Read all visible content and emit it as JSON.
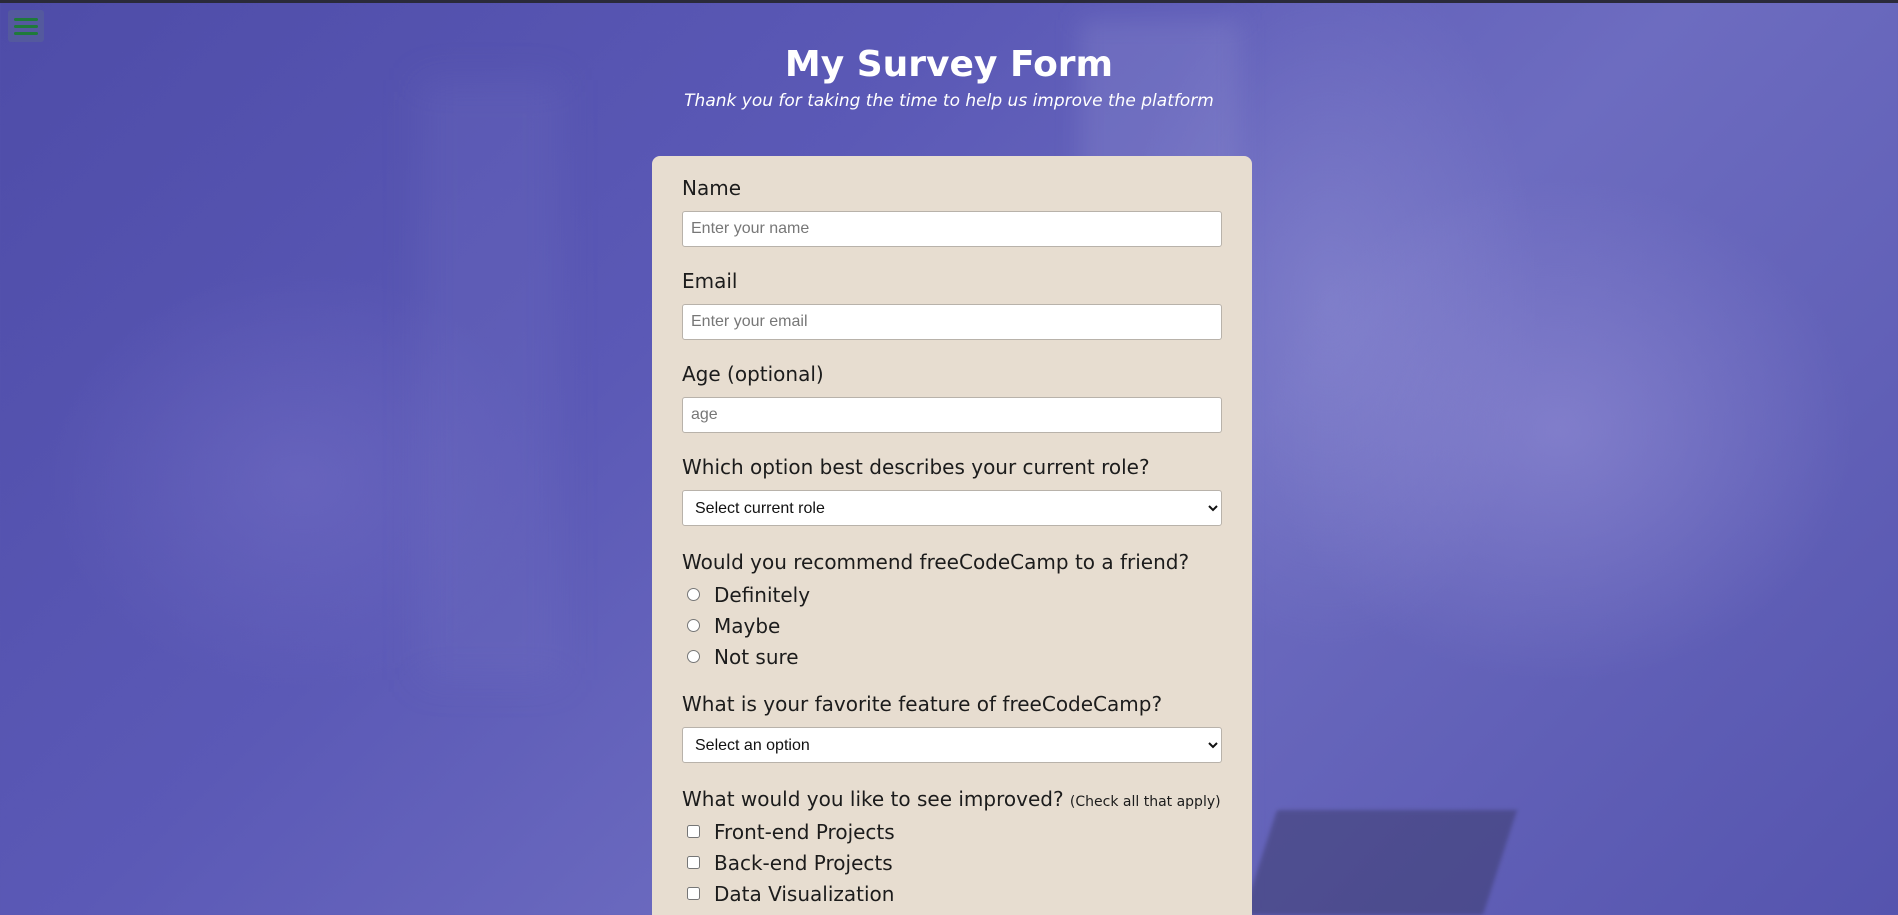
{
  "menu": {
    "icon": "hamburger-menu-icon"
  },
  "header": {
    "title": "My Survey Form",
    "description": "Thank you for taking the time to help us improve the platform"
  },
  "form": {
    "name": {
      "label": "Name",
      "placeholder": "Enter your name"
    },
    "email": {
      "label": "Email",
      "placeholder": "Enter your email"
    },
    "age": {
      "label": "Age (optional)",
      "placeholder": "age"
    },
    "role": {
      "label": "Which option best describes your current role?",
      "selected": "Select current role"
    },
    "recommend": {
      "label": "Would you recommend freeCodeCamp to a friend?",
      "options": [
        "Definitely",
        "Maybe",
        "Not sure"
      ]
    },
    "favorite": {
      "label": "What is your favorite feature of freeCodeCamp?",
      "selected": "Select an option"
    },
    "improve": {
      "label": "What would you like to see improved?",
      "note": "(Check all that apply)",
      "options": [
        "Front-end Projects",
        "Back-end Projects",
        "Data Visualization"
      ]
    }
  },
  "colors": {
    "background": "#5b59b6",
    "card": "#e7ddd0",
    "menu_icon": "#1f7a3a",
    "header_text": "#ffffff"
  }
}
